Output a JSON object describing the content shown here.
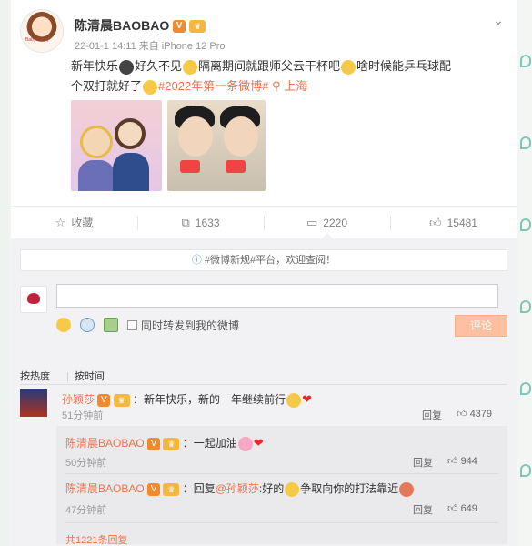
{
  "post": {
    "username": "陈清晨BAOBAO",
    "meta": "22-01-1 14:11 来自 iPhone 12 Pro",
    "text_part1": "新年快乐",
    "text_part2": "好久不见",
    "text_part3": "隔离期间就跟师父云干杯吧",
    "text_part4": "啥时候能乒乓球配个双打就好了",
    "hashtag": "#2022年第一条微博#",
    "location": "上海",
    "avatar_caption": "Baby Lucky"
  },
  "actions": {
    "favorite": "收藏",
    "repost": "1633",
    "comment": "2220",
    "like": "15481"
  },
  "comments": {
    "notice": "#微博新规#平台，欢迎查阅！",
    "input_placeholder": "",
    "forward_label": "同时转发到我的微博",
    "submit_label": "评论",
    "sort_hot": "按热度",
    "sort_time": "按时间",
    "top": {
      "name": "孙颖莎",
      "text": "：新年快乐，新的一年继续前行",
      "time": "51分钟前",
      "reply": "回复",
      "likes": "4379"
    },
    "replies": [
      {
        "name": "陈清晨BAOBAO",
        "text": "：一起加油",
        "time": "50分钟前",
        "reply": "回复",
        "likes": "944"
      },
      {
        "name": "陈清晨BAOBAO",
        "text_prefix": "：回复",
        "mention": "@孙颖莎",
        "text_suffix": ":好的",
        "text_end": "争取向你的打法靠近",
        "time": "47分钟前",
        "reply": "回复",
        "likes": "649"
      }
    ],
    "more_replies": "共1221条回复"
  }
}
